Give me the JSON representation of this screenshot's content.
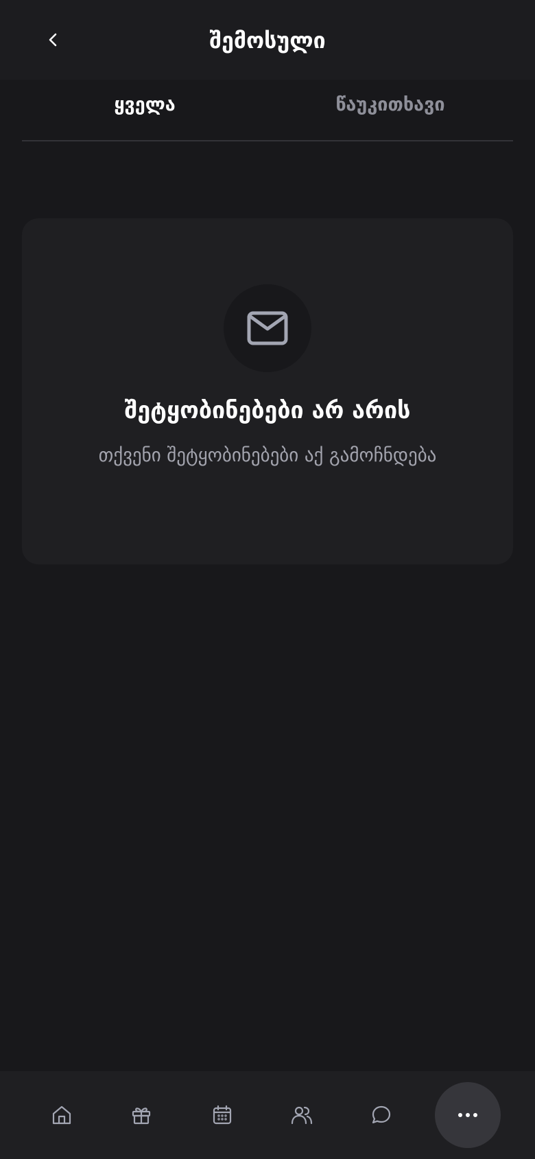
{
  "header": {
    "title": "შემოსული",
    "back_icon": "chevron-left-icon"
  },
  "tabs": [
    {
      "label": "ყველა",
      "active": true
    },
    {
      "label": "წაუკითხავი",
      "active": false
    }
  ],
  "empty_state": {
    "icon": "mail-icon",
    "title": "შეტყობინებები არ არის",
    "subtitle": "თქვენი შეტყობინებები აქ გამოჩნდება"
  },
  "bottom_nav": {
    "items": [
      {
        "icon": "home-icon"
      },
      {
        "icon": "gift-icon"
      },
      {
        "icon": "calendar-icon"
      },
      {
        "icon": "users-icon"
      },
      {
        "icon": "chat-icon"
      }
    ],
    "more_icon": "more-dots-icon"
  },
  "colors": {
    "background": "#18181b",
    "card": "#1f1f22",
    "inactive_text": "#8e8f99",
    "icon_gray": "#a3a6b3"
  }
}
